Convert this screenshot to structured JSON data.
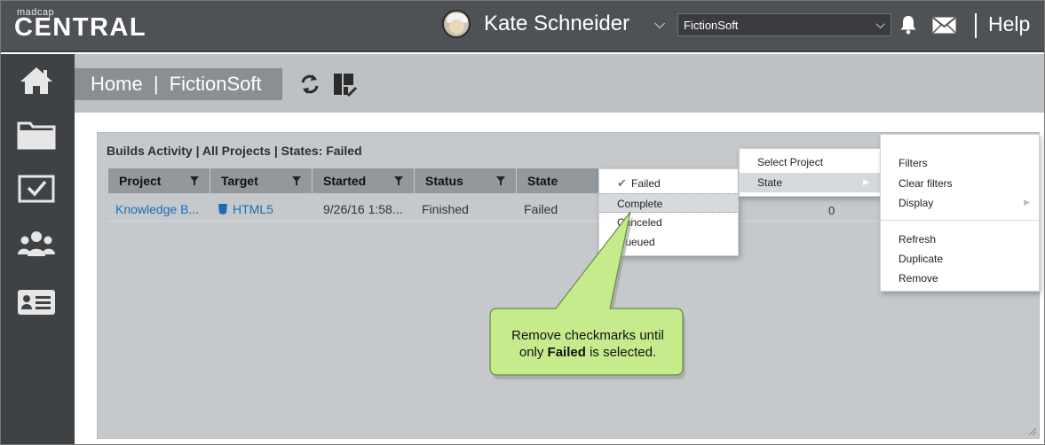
{
  "app": {
    "logo_small": "madcap",
    "logo_big": "CENTRAL"
  },
  "header": {
    "username": "Kate Schneider",
    "org_select_value": "FictionSoft",
    "help_label": "Help"
  },
  "sidebar": {
    "items": [
      {
        "icon": "home-icon"
      },
      {
        "icon": "folder-icon"
      },
      {
        "icon": "checklist-icon"
      },
      {
        "icon": "users-icon"
      },
      {
        "icon": "license-card-icon"
      }
    ]
  },
  "page": {
    "breadcrumb_home": "Home",
    "breadcrumb_sep": "|",
    "breadcrumb_org": "FictionSoft"
  },
  "widget": {
    "title": "Builds Activity | All Projects | States: Failed",
    "columns": [
      "Project",
      "Target",
      "Started",
      "Status",
      "State"
    ],
    "rows": [
      {
        "project": "Knowledge B...",
        "target": "HTML5",
        "started": "9/26/16 1:58...",
        "status": "Finished",
        "state": "Failed",
        "count": "0"
      }
    ]
  },
  "state_menu": {
    "items": [
      "Failed",
      "Complete",
      "Canceled",
      "Queued"
    ],
    "checked": "Failed",
    "hovered": "Complete"
  },
  "context_menu": {
    "items": [
      "Select Project",
      "State"
    ],
    "active": "State"
  },
  "widget_menu": {
    "group1": [
      "Filters",
      "Clear filters",
      "Display"
    ],
    "group2": [
      "Refresh",
      "Duplicate",
      "Remove"
    ]
  },
  "callout": {
    "line1": "Remove checkmarks until",
    "line2_prefix": "only ",
    "line2_bold": "Failed",
    "line2_suffix": " is selected.",
    "fill": "#c5eb8c"
  }
}
